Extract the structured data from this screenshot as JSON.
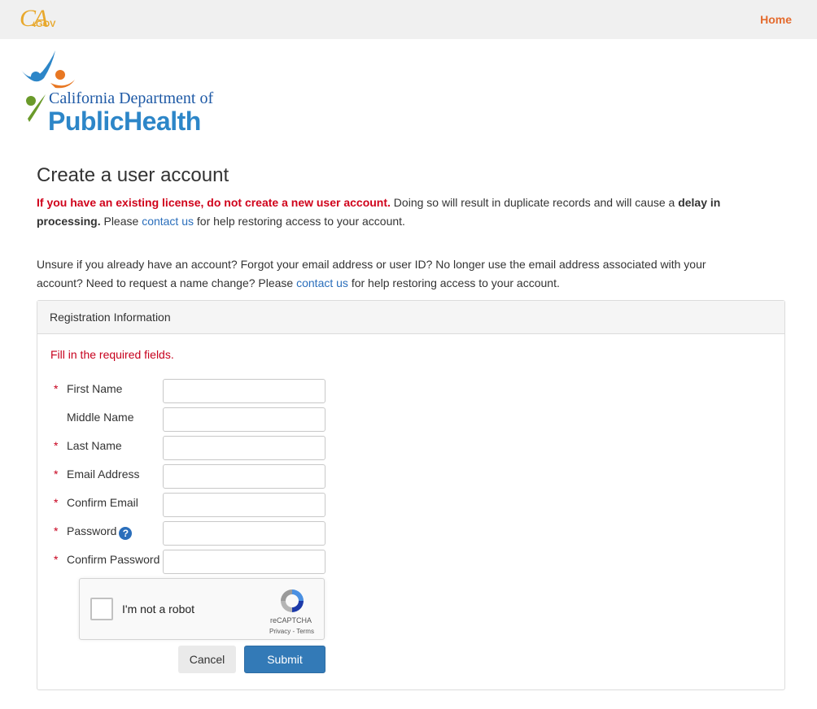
{
  "header": {
    "ca_logo_main": "CA",
    "ca_logo_sub": ".GOV",
    "home_link": "Home",
    "brand_color": "#e8a82c",
    "link_color": "#e46b2e"
  },
  "agency_logo": {
    "line1": "California Department of",
    "line2": "PublicHealth"
  },
  "page": {
    "title": "Create a user account",
    "notice1": {
      "warning": "If you have an existing license, do not create a new user account.",
      "text_a": " Doing so will result in duplicate records and will cause a ",
      "bold": "delay in processing.",
      "text_b": " Please ",
      "link": "contact us",
      "text_c": " for help restoring access to your account."
    },
    "notice2": {
      "text_a": "Unsure if you already have an account? Forgot your email address or user ID? No longer use the email address associated with your account? Need to request a name change? Please ",
      "link": "contact us",
      "text_b": " for help restoring access to your account."
    }
  },
  "form": {
    "panel_title": "Registration Information",
    "required_note": "Fill in the required fields.",
    "required_marker": "*",
    "fields": [
      {
        "label": "First Name",
        "required": true,
        "value": ""
      },
      {
        "label": "Middle Name",
        "required": false,
        "value": ""
      },
      {
        "label": "Last Name",
        "required": true,
        "value": ""
      },
      {
        "label": "Email Address",
        "required": true,
        "value": ""
      },
      {
        "label": "Confirm Email",
        "required": true,
        "value": ""
      },
      {
        "label": "Password",
        "required": true,
        "value": "",
        "help_icon": "?"
      },
      {
        "label": "Confirm Password",
        "required": true,
        "value": ""
      }
    ],
    "captcha": {
      "label": "I'm not a robot",
      "brand": "reCAPTCHA",
      "terms": "Privacy - Terms",
      "checked": false
    },
    "cancel_label": "Cancel",
    "submit_label": "Submit",
    "submit_color": "#337ab7"
  }
}
